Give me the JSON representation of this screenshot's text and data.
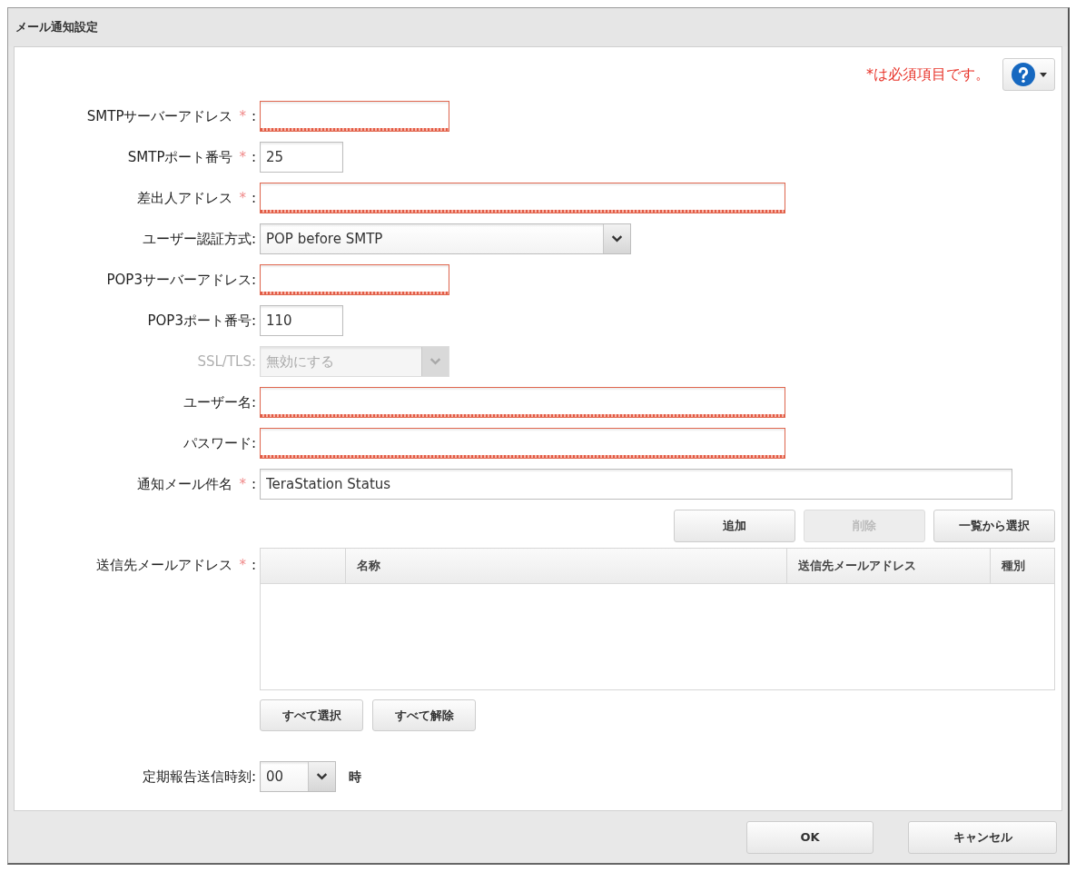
{
  "window": {
    "title": "メール通知設定"
  },
  "required_note": "*は必須項目です。",
  "fields": [
    {
      "kind": "text",
      "label": "SMTPサーバーアドレス",
      "required_mark": "*",
      "colon": ":",
      "invalid": true,
      "disabled": false
    },
    {
      "kind": "text",
      "label": "SMTPポート番号",
      "required_mark": "*",
      "colon": ":",
      "value": "25",
      "invalid": false,
      "disabled": false
    },
    {
      "kind": "text",
      "label": "差出人アドレス",
      "required_mark": "*",
      "colon": ":",
      "invalid": true,
      "disabled": false
    },
    {
      "kind": "select",
      "label": "ユーザー認証方式",
      "colon": ":",
      "value": "POP before SMTP",
      "invalid": false,
      "disabled": false
    },
    {
      "kind": "text",
      "label": "POP3サーバーアドレス",
      "colon": ":",
      "invalid": true,
      "disabled": false
    },
    {
      "kind": "text",
      "label": "POP3ポート番号",
      "colon": ":",
      "value": "110",
      "invalid": false,
      "disabled": false
    },
    {
      "kind": "select",
      "label": "SSL/TLS",
      "colon": ":",
      "value": "無効にする",
      "invalid": false,
      "disabled": true
    },
    {
      "kind": "text",
      "label": "ユーザー名",
      "colon": ":",
      "invalid": true,
      "disabled": false
    },
    {
      "kind": "password",
      "label": "パスワード",
      "colon": ":",
      "invalid": true,
      "disabled": false
    },
    {
      "kind": "text",
      "label": "通知メール件名",
      "required_mark": "*",
      "colon": ":",
      "value": "TeraStation Status",
      "invalid": false,
      "disabled": false
    }
  ],
  "recipient_buttons": [
    {
      "label": "追加",
      "disabled": false
    },
    {
      "label": "削除",
      "disabled": true
    },
    {
      "label": "一覧から選択",
      "disabled": false
    }
  ],
  "recipients": {
    "label": "送信先メールアドレス",
    "required_mark": "*",
    "colon": ":",
    "columns": [
      "名称",
      "送信先メールアドレス",
      "種別"
    ]
  },
  "selection_buttons": [
    "すべて選択",
    "すべて解除"
  ],
  "report_time": {
    "label": "定期報告送信時刻",
    "colon": ":",
    "value": "00",
    "unit": "時"
  },
  "footer_buttons": [
    "OK",
    "キャンセル"
  ]
}
